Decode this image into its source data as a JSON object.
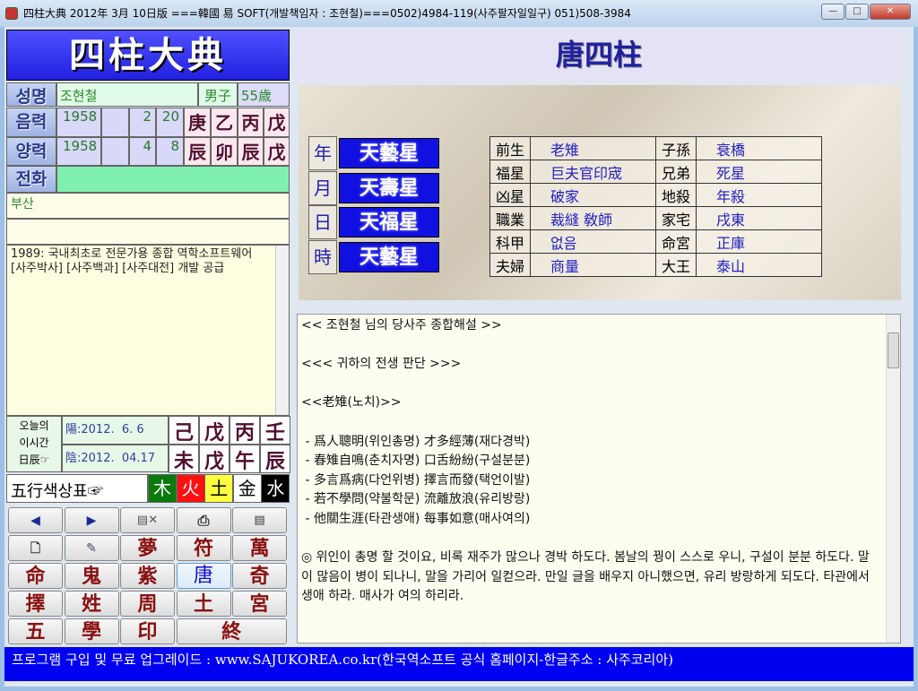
{
  "window": {
    "title": "四柱大典 2012年 3月 10日版 ===韓國 易 SOFT(개발책임자 : 조현철)===0502)4984-119(사주팔자일일구) 051)508-3984",
    "min": "—",
    "max": "□",
    "close": "✕"
  },
  "left": {
    "logo": "四柱大典",
    "name_label": "성명",
    "name": "조현철",
    "gender": "男子",
    "age": "55歲",
    "lunar_label": "음력",
    "lunar": {
      "year": "1958",
      "blank": "",
      "month": "2",
      "day": "20",
      "chars": [
        "庚",
        "乙",
        "丙",
        "戊"
      ]
    },
    "solar_label": "양력",
    "solar": {
      "year": "1958",
      "blank": "",
      "month": "4",
      "day": "8",
      "chars": [
        "辰",
        "卯",
        "辰",
        "戊"
      ]
    },
    "phone_label": "전화",
    "phone": "",
    "address": "부산",
    "memo": "1989: 국내최초로 전문가용 종합 역학소프트웨어 [사주박사] [사주백과] [사주대전] 개발 공급",
    "today": {
      "label": "오늘의\n이시간\n日辰☞",
      "solar": "陽:2012.  6. 6",
      "lunar": "陰:2012.  04.17",
      "top": [
        "己",
        "戊",
        "丙",
        "壬"
      ],
      "bottom": [
        "未",
        "戊",
        "午",
        "辰"
      ]
    },
    "five": {
      "label": "五行색상표☞",
      "items": [
        {
          "t": "木",
          "bg": "#0a7a0a",
          "fg": "#fff"
        },
        {
          "t": "火",
          "bg": "#ff1010",
          "fg": "#fff"
        },
        {
          "t": "土",
          "bg": "#ffff40",
          "fg": "#000"
        },
        {
          "t": "金",
          "bg": "#ffffff",
          "fg": "#000"
        },
        {
          "t": "水",
          "bg": "#000000",
          "fg": "#fff"
        }
      ]
    },
    "buttons": {
      "prev": "◀",
      "next": "▶",
      "delete": "▤✕",
      "print": "⎙",
      "save": "▤",
      "new": "🗋",
      "edit": "✎",
      "r2": [
        "夢",
        "符",
        "萬"
      ],
      "r3": [
        "命",
        "鬼",
        "紫",
        "唐",
        "奇"
      ],
      "r4": [
        "擇",
        "姓",
        "周",
        "土",
        "宮"
      ],
      "r5": [
        "五",
        "學",
        "印",
        "終"
      ]
    }
  },
  "right": {
    "title": "唐四柱",
    "pillars": [
      {
        "k": "年",
        "v": "天藝星"
      },
      {
        "k": "月",
        "v": "天壽星"
      },
      {
        "k": "日",
        "v": "天福星"
      },
      {
        "k": "時",
        "v": "天藝星"
      }
    ],
    "table": [
      [
        "前生",
        "老雉",
        "子孫",
        "衰橋"
      ],
      [
        "福星",
        "巨夫官印宬",
        "兄弟",
        "死星"
      ],
      [
        "凶星",
        "破家",
        "地殺",
        "年殺"
      ],
      [
        "職業",
        "裁縫 敎師",
        "家宅",
        "戌東"
      ],
      [
        "科甲",
        "없음",
        "命宮",
        "正庫"
      ],
      [
        "夫婦",
        "商量",
        "大王",
        "泰山"
      ]
    ],
    "text": "<< 조현철 님의 당사주 종합해설 >>\n\n<<< 귀하의 전생 판단 >>>\n\n<<老雉(노치)>>\n\n - 爲人聰明(위인총명) 才多經薄(재다경박)\n - 春雉自鳴(춘치자명) 口舌紛紛(구설분분)\n - 多言爲病(다언위병) 擇言而發(택언이발)\n - 若不學問(약불학문) 流離放浪(유리방랑)\n - 他關生涯(타관생애) 每事如意(매사여의)\n\n◎ 위인이 총명 할 것이요, 비록 재주가 많으나 경박 하도다. 봄날의 꿩이 스스로 우니, 구설이 분분 하도다. 말이 많음이 병이 되나니, 말을 가리어 일컫으라. 만일 글을 배우지 아니했으면, 유리 방랑하게 되도다. 타관에서 생애 하라. 매사가 여의 하리라."
  },
  "footer": "프로그램 구입 및 무료 업그레이드 : www.SAJUKOREA.co.kr(한국역소프트 공식 홈페이지-한글주소 : 사주코리아)"
}
